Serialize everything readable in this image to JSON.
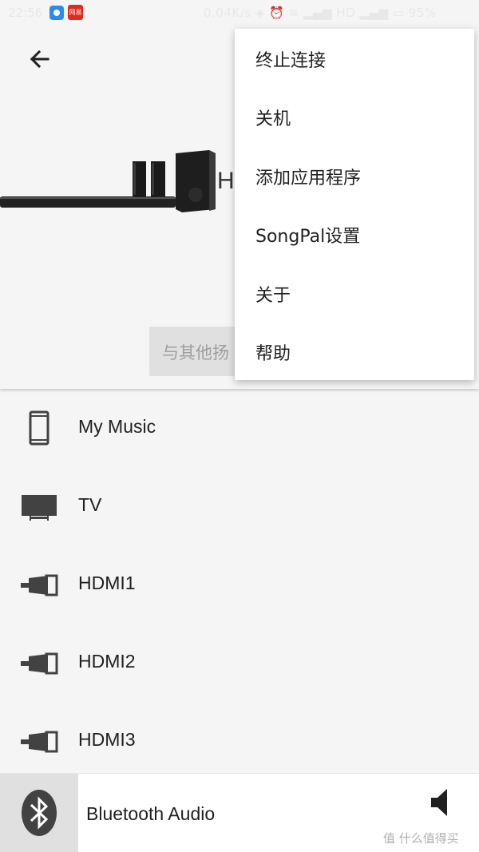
{
  "status_bar": {
    "time": "22:56",
    "app_badge_text": "网易",
    "right_text": "0.04K/s  ◈  ⏰  ≋  ▂▄▆  HD  ▂▄▆  ▭  95%"
  },
  "header": {
    "device_name_partial": "H",
    "group_button_partial": "与其他扬"
  },
  "sources": [
    {
      "label": "My Music",
      "icon": "phone-icon"
    },
    {
      "label": "TV",
      "icon": "tv-icon"
    },
    {
      "label": "HDMI1",
      "icon": "hdmi-icon"
    },
    {
      "label": "HDMI2",
      "icon": "hdmi-icon"
    },
    {
      "label": "HDMI3",
      "icon": "hdmi-icon"
    }
  ],
  "now_playing": {
    "label": "Bluetooth Audio",
    "icon": "bluetooth-icon",
    "volume_icon": "speaker-icon"
  },
  "watermark": "值 什么值得买",
  "menu": {
    "items": [
      {
        "label": "终止连接"
      },
      {
        "label": "关机"
      },
      {
        "label": "添加应用程序"
      },
      {
        "label": "SongPal设置"
      },
      {
        "label": "关于"
      },
      {
        "label": "帮助"
      }
    ]
  },
  "colors": {
    "background": "#f5f5f5",
    "icon_gray": "#424242",
    "tile_gray": "#e0e0e0"
  }
}
